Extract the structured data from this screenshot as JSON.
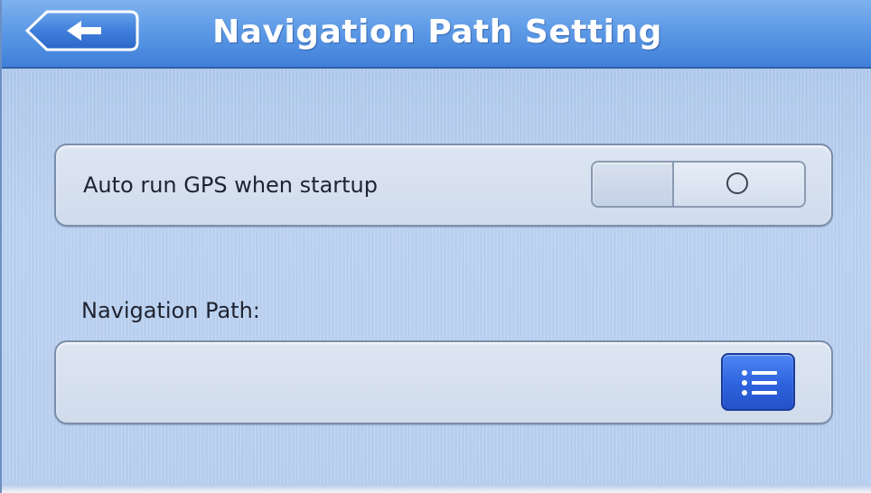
{
  "header": {
    "title": "Navigation Path Setting",
    "back_icon": "back-arrow-icon"
  },
  "auto_run": {
    "label": "Auto run GPS when startup",
    "toggle_state": "off",
    "toggle_icon": "circle-icon"
  },
  "navigation_path": {
    "label": "Navigation Path:",
    "value": "",
    "browse_icon": "list-icon"
  },
  "colors": {
    "header": "#4f8fe3",
    "background": "#b6cdee",
    "panel": "#d6e0ee",
    "browse_button": "#2e62de"
  }
}
